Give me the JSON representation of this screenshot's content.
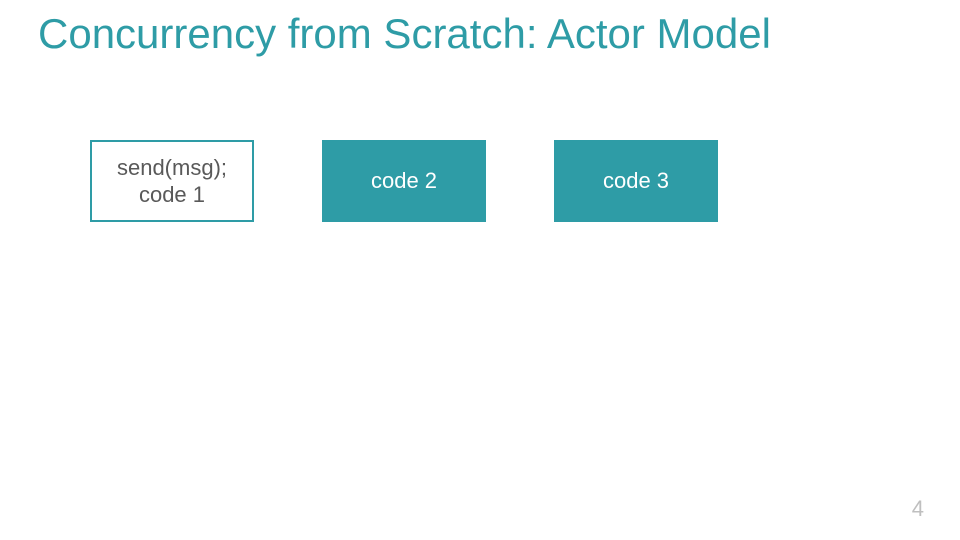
{
  "title": "Concurrency from Scratch: Actor Model",
  "boxes": {
    "b1_line1": "send(msg);",
    "b1_line2": "code 1",
    "b2": "code 2",
    "b3": "code 3"
  },
  "page_number": "4"
}
